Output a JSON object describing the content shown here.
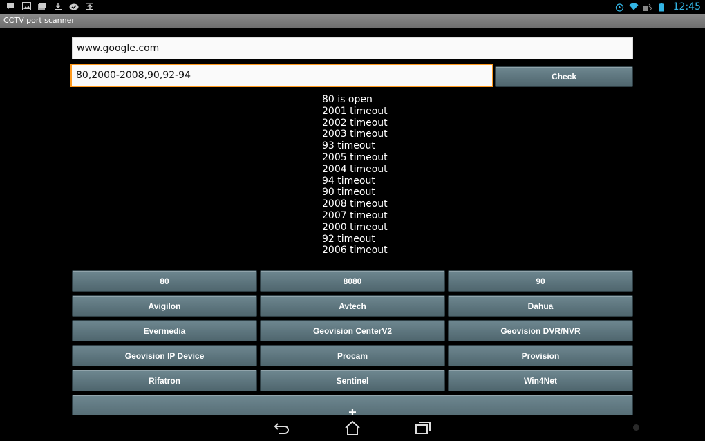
{
  "status_bar": {
    "left_icons": [
      "message-icon",
      "image-icon",
      "photos-icon",
      "download-icon",
      "checkmark-cloud-icon",
      "upload-tray-icon"
    ],
    "right_icons": [
      "alarm-icon",
      "wifi-icon",
      "signal-icon",
      "battery-icon"
    ],
    "time": "12:45",
    "time_color": "#33b5e5"
  },
  "app": {
    "title": "CCTV port scanner"
  },
  "form": {
    "host_value": "www.google.com",
    "ports_value": "80,2000-2008,90,92-94",
    "check_label": "Check",
    "focus_color": "#ff9a1e"
  },
  "results": [
    "80 is open",
    "2001 timeout",
    "2002 timeout",
    "2003 timeout",
    "93 timeout",
    "2005 timeout",
    "2004 timeout",
    "94 timeout",
    "90 timeout",
    "2008 timeout",
    "2007 timeout",
    "2000 timeout",
    "92 timeout",
    "2006 timeout"
  ],
  "presets": [
    "80",
    "8080",
    "90",
    "Avigilon",
    "Avtech",
    "Dahua",
    "Evermedia",
    "Geovision CenterV2",
    "Geovision DVR/NVR",
    "Geovision IP Device",
    "Procam",
    "Provision",
    "Rifatron",
    "Sentinel",
    "Win4Net"
  ],
  "add_label": "+",
  "nav": [
    "back-icon",
    "home-icon",
    "recent-apps-icon"
  ]
}
